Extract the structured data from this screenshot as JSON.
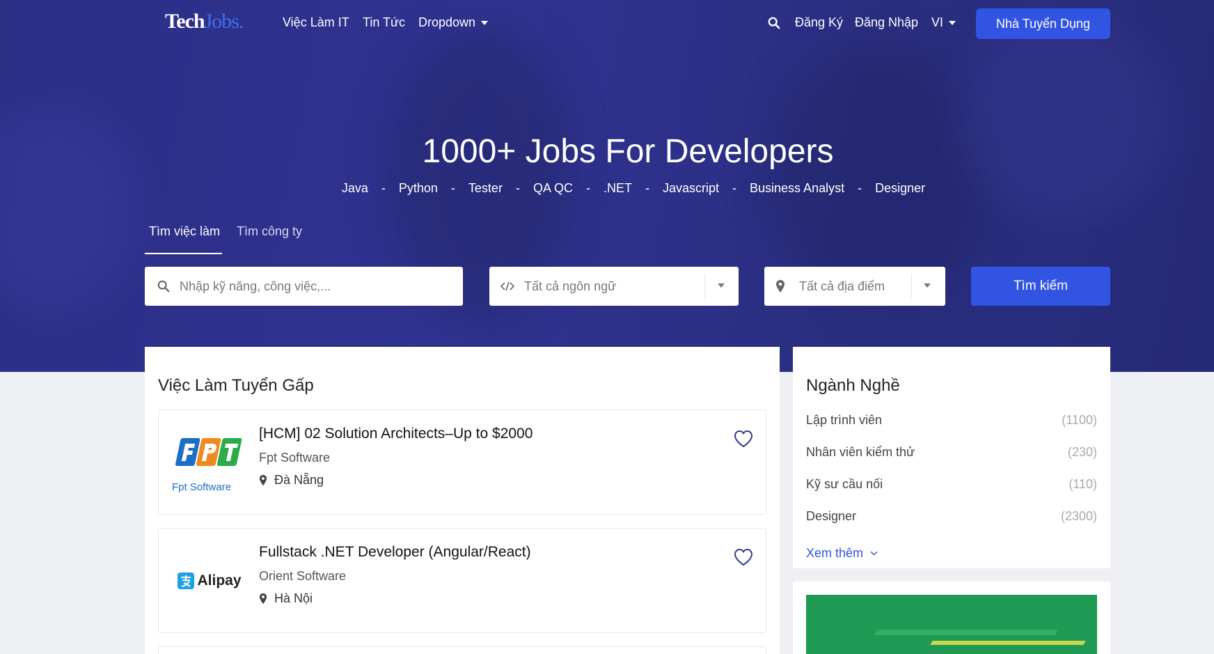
{
  "nav": {
    "logo_a": "Tech",
    "logo_b": "Jobs.",
    "links": [
      "Việc Làm IT",
      "Tin Tức",
      "Dropdown"
    ],
    "register": "Đăng Ký",
    "login": "Đăng Nhập",
    "lang": "VI",
    "employer": "Nhà Tuyển Dụng"
  },
  "hero": {
    "title": "1000+ Jobs For Developers",
    "tags": [
      "Java",
      "Python",
      "Tester",
      "QA QC",
      ".NET",
      "Javascript",
      "Business Analyst",
      "Designer"
    ],
    "separator": "-"
  },
  "search": {
    "tabs": [
      "Tìm việc làm",
      "Tìm công ty"
    ],
    "keyword_placeholder": "Nhập kỹ năng, công việc,...",
    "language_value": "Tất cả ngôn ngữ",
    "location_value": "Tất cả địa điểm",
    "submit": "Tìm kiếm"
  },
  "urgent": {
    "title": "Việc Làm Tuyển Gấp",
    "jobs": [
      {
        "title": "[HCM] 02 Solution Architects–Up to $2000",
        "company": "Fpt Software",
        "location": "Đà Nẵng",
        "logo_text": "Fpt Software"
      },
      {
        "title": "Fullstack .NET Developer (Angular/React)",
        "company": "Orient Software",
        "location": "Hà Nội",
        "logo_text": "Alipay"
      }
    ]
  },
  "categories": {
    "title": "Ngành Nghề",
    "items": [
      {
        "label": "Lập trình viên",
        "count": "(1100)"
      },
      {
        "label": "Nhân viên kiểm thử",
        "count": "(230)"
      },
      {
        "label": "Kỹ sư cầu nối",
        "count": "(110)"
      },
      {
        "label": "Designer",
        "count": "(2300)"
      }
    ],
    "more": "Xem thêm"
  },
  "colors": {
    "primary": "#3254e3",
    "hero": "#2f3390",
    "banner": "#1f9a54"
  }
}
